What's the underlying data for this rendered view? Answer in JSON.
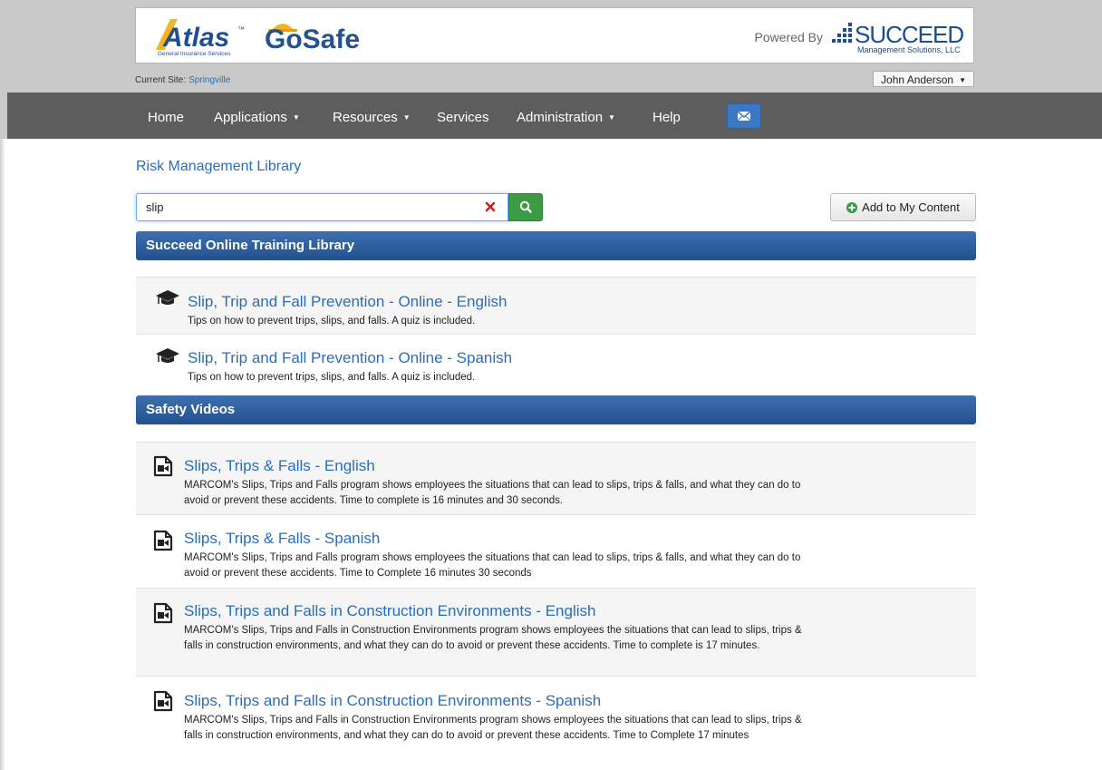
{
  "header": {
    "atlas_word": "Atlas",
    "atlas_tm": "™",
    "atlas_sub": "General Insurance Services",
    "gosafe": "GoSafe",
    "powered_by": "Powered By",
    "succeed_word": "SUCCEED",
    "succeed_sub": "Management Solutions, LLC"
  },
  "site": {
    "label": "Current Site:",
    "name": "Springville",
    "user": "John Anderson"
  },
  "nav": {
    "items": [
      {
        "label": "Home"
      },
      {
        "label": "Applications"
      },
      {
        "label": "Resources"
      },
      {
        "label": "Services"
      },
      {
        "label": "Administration"
      },
      {
        "label": "Help"
      }
    ],
    "mail_icon": "envelope-icon"
  },
  "page": {
    "title": "Risk Management Library"
  },
  "search": {
    "value": "slip"
  },
  "actions": {
    "add_label": "Add to My Content"
  },
  "sections": [
    {
      "title": "Succeed Online Training Library",
      "icon": "graduation-cap-icon",
      "items": [
        {
          "title": "Slip, Trip and Fall Prevention - Online - English",
          "desc": "Tips on how to prevent trips, slips, and falls. A quiz is included."
        },
        {
          "title": "Slip, Trip and Fall Prevention - Online - Spanish",
          "desc": "Tips on how to prevent trips, slips, and falls. A quiz is included."
        }
      ]
    },
    {
      "title": "Safety Videos",
      "icon": "video-file-icon",
      "items": [
        {
          "title": "Slips, Trips & Falls - English",
          "desc": "MARCOM's Slips, Trips and Falls program shows employees the situations that can lead to slips, trips & falls, and what they can do to avoid or prevent these accidents. Time to complete is 16 minutes and 30 seconds."
        },
        {
          "title": "Slips, Trips & Falls - Spanish",
          "desc": "MARCOM's Slips, Trips and Falls program shows employees the situations that can lead to slips, trips & falls, and what they can do to avoid or prevent these accidents. Time to Complete 16 minutes 30 seconds"
        },
        {
          "title": "Slips, Trips and Falls in Construction Environments - English",
          "desc": "MARCOM's Slips, Trips and Falls in Construction Environments program shows employees the situations that can lead to slips, trips & falls in construction environments, and what they can do to avoid or prevent these accidents. Time to complete is 17 minutes."
        },
        {
          "title": "Slips, Trips and Falls in Construction Environments - Spanish",
          "desc": "MARCOM's Slips, Trips and Falls in Construction Environments program shows employees the situations that can lead to slips, trips & falls in construction environments, and what they can do to avoid or prevent these accidents. Time to Complete 17 minutes"
        }
      ]
    }
  ],
  "colors": {
    "link": "#2a6ebb",
    "navbar": "#5d5d5d",
    "section_header": "#2e5d9c",
    "search_button": "#3d9a45",
    "atlas_blue": "#1f4e93",
    "gosafe_blue": "#24528f",
    "hardhat_yellow": "#f3b323"
  }
}
